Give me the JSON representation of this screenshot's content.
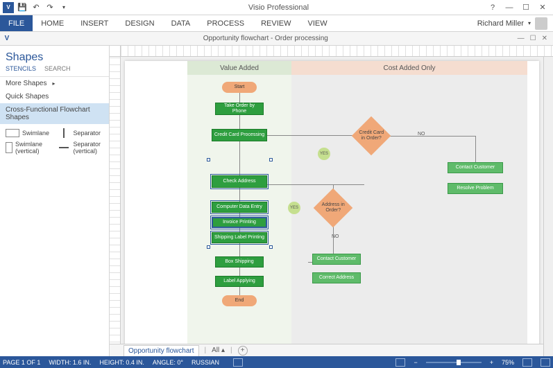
{
  "app": {
    "title": "Visio Professional"
  },
  "qat": {
    "save": "💾",
    "undo": "↶",
    "redo": "↷"
  },
  "ribbon": {
    "file": "FILE",
    "tabs": [
      "HOME",
      "INSERT",
      "DESIGN",
      "DATA",
      "PROCESS",
      "REVIEW",
      "VIEW"
    ],
    "user": "Richard Miller"
  },
  "doc": {
    "title": "Opportunity flowchart - Order processing"
  },
  "shapes": {
    "title": "Shapes",
    "tabs": {
      "stencils": "STENCILS",
      "search": "SEARCH"
    },
    "more": "More Shapes",
    "quick": "Quick Shapes",
    "category": "Cross-Functional Flowchart Shapes",
    "items": {
      "swimlane": "Swimlane",
      "separator": "Separator",
      "swimlane_v": "Swimlane (vertical)",
      "separator_v": "Separator (vertical)"
    }
  },
  "flow": {
    "lane1": "Value Added",
    "lane2": "Cost Added Only",
    "start": "Start",
    "take_order": "Take Order by Phone",
    "cc_processing": "Credit Card Processing",
    "check_address": "Check Address",
    "data_entry": "Computer Data Entry",
    "invoice": "Invoice Printing",
    "label_print": "Shipping Label Printing",
    "box_ship": "Box Shipping",
    "label_apply": "Label Applying",
    "end": "End",
    "dec_cc": "Credit Card in Order?",
    "dec_addr": "Address in Order?",
    "contact1": "Contact Customer",
    "resolve": "Resolve Problem",
    "contact2": "Contact Customer",
    "correct": "Correct Address",
    "yes": "YES",
    "no": "NO"
  },
  "pagetabs": {
    "name": "Opportunity flowchart",
    "all": "All"
  },
  "status": {
    "page": "PAGE 1 OF 1",
    "width": "WIDTH: 1.6 IN.",
    "height": "HEIGHT: 0.4 IN.",
    "angle": "ANGLE: 0°",
    "lang": "RUSSIAN",
    "zoom": "75%"
  }
}
